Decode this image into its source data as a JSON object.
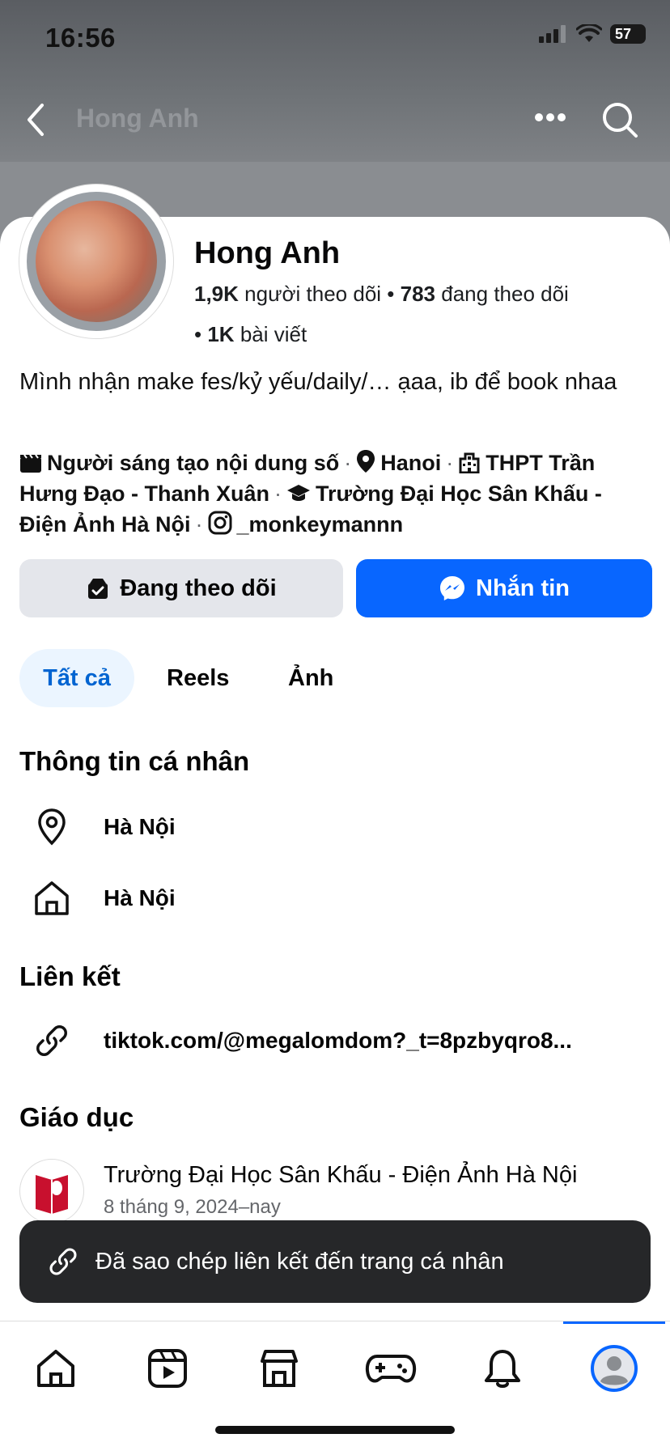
{
  "status_bar": {
    "time": "16:56",
    "battery": "57"
  },
  "header": {
    "title": "Hong Anh"
  },
  "profile": {
    "name": "Hong Anh",
    "followers_count": "1,9K",
    "followers_label": "người theo dõi",
    "following_count": "783",
    "following_label": "đang theo dõi",
    "posts_count": "1K",
    "posts_label": "bài viết",
    "bio": "Mình nhận make fes/kỷ yếu/daily/… ạaa, ib để book nhaa",
    "details": {
      "creator": "Người sáng tạo nội dung số",
      "location": "Hanoi",
      "highschool": "THPT Trần Hưng Đạo - Thanh Xuân",
      "university": "Trường Đại Học Sân Khấu - Điện Ảnh Hà Nội",
      "instagram": "_monkeymannn"
    }
  },
  "buttons": {
    "following": "Đang theo dõi",
    "message": "Nhắn tin"
  },
  "tabs": [
    {
      "label": "Tất cả",
      "active": true
    },
    {
      "label": "Reels",
      "active": false
    },
    {
      "label": "Ảnh",
      "active": false
    }
  ],
  "personal_info": {
    "title": "Thông tin cá nhân",
    "current_city": "Hà Nội",
    "hometown": "Hà Nội"
  },
  "links": {
    "title": "Liên kết",
    "tiktok": "tiktok.com/@megalomdom?_t=8pzbyqro8..."
  },
  "education": {
    "title": "Giáo dục",
    "school": "Trường Đại Học Sân Khấu - Điện Ảnh Hà Nội",
    "dates": "8 tháng 9, 2024–nay"
  },
  "toast": {
    "message": "Đã sao chép liên kết đến trang cá nhân"
  },
  "bottom_nav": [
    "home-icon",
    "video-icon",
    "marketplace-icon",
    "gaming-icon",
    "notifications-icon",
    "profile-icon"
  ],
  "colors": {
    "accent": "#0866ff",
    "tab_active_bg": "#ebf5ff",
    "tab_active_text": "#0064d1",
    "toast_bg": "#262729"
  }
}
